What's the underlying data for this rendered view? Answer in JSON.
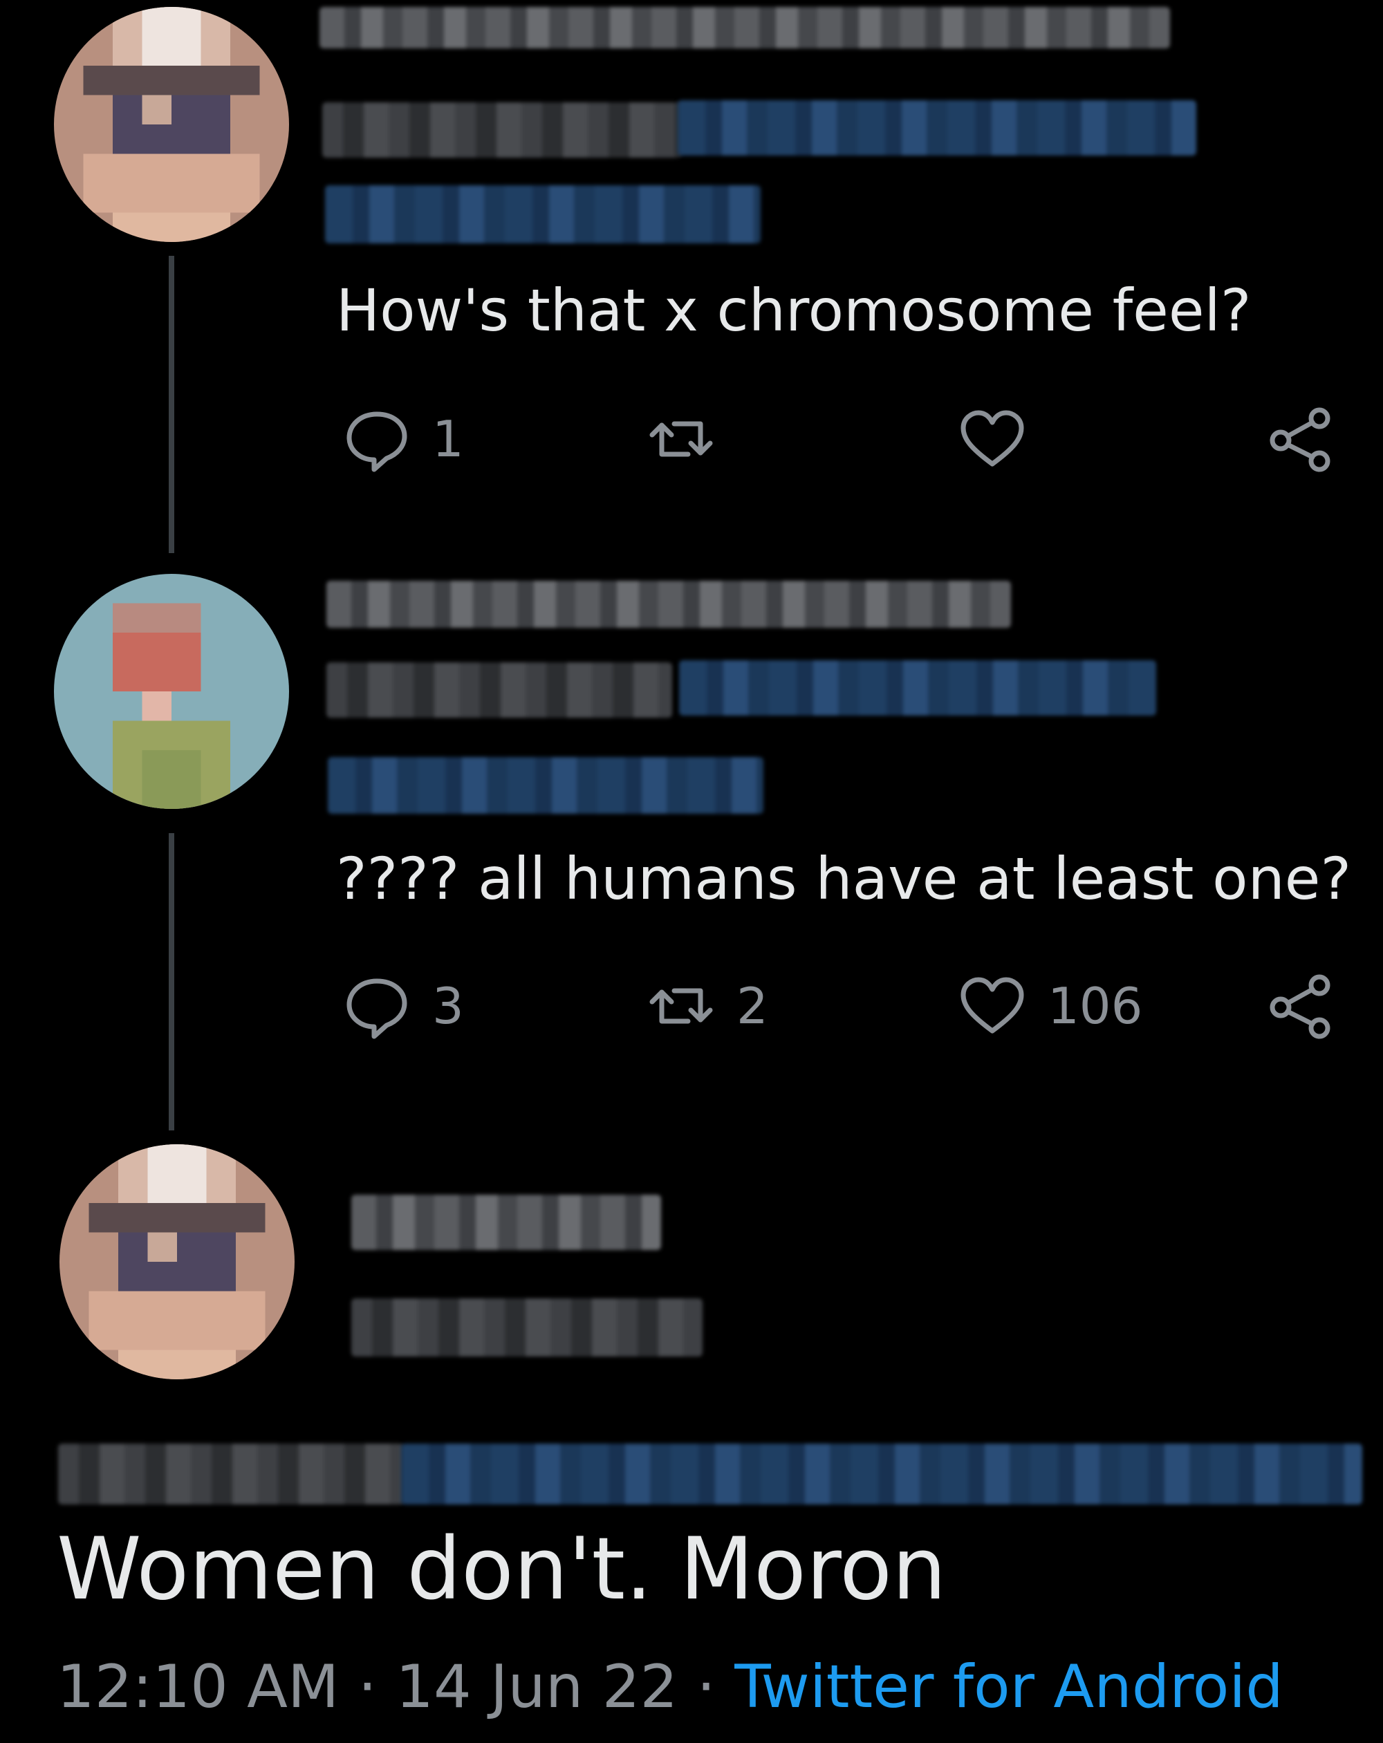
{
  "thread": [
    {
      "text": "How's that x chromosome feel?",
      "actions": {
        "reply_count": "1",
        "retweet_count": "",
        "like_count": ""
      }
    },
    {
      "text": "???? all humans have at least one?",
      "actions": {
        "reply_count": "3",
        "retweet_count": "2",
        "like_count": "106"
      }
    }
  ],
  "main_tweet": {
    "text": "Women don't. Moron",
    "time": "12:10 AM",
    "separator": "·",
    "date": "14 Jun 22",
    "source": "Twitter for Android"
  },
  "colors": {
    "background": "#000000",
    "text": "#e7e9ea",
    "muted": "#8b9096",
    "link": "#1d9bf0"
  },
  "icons": [
    "reply-icon",
    "retweet-icon",
    "like-icon",
    "share-icon"
  ]
}
